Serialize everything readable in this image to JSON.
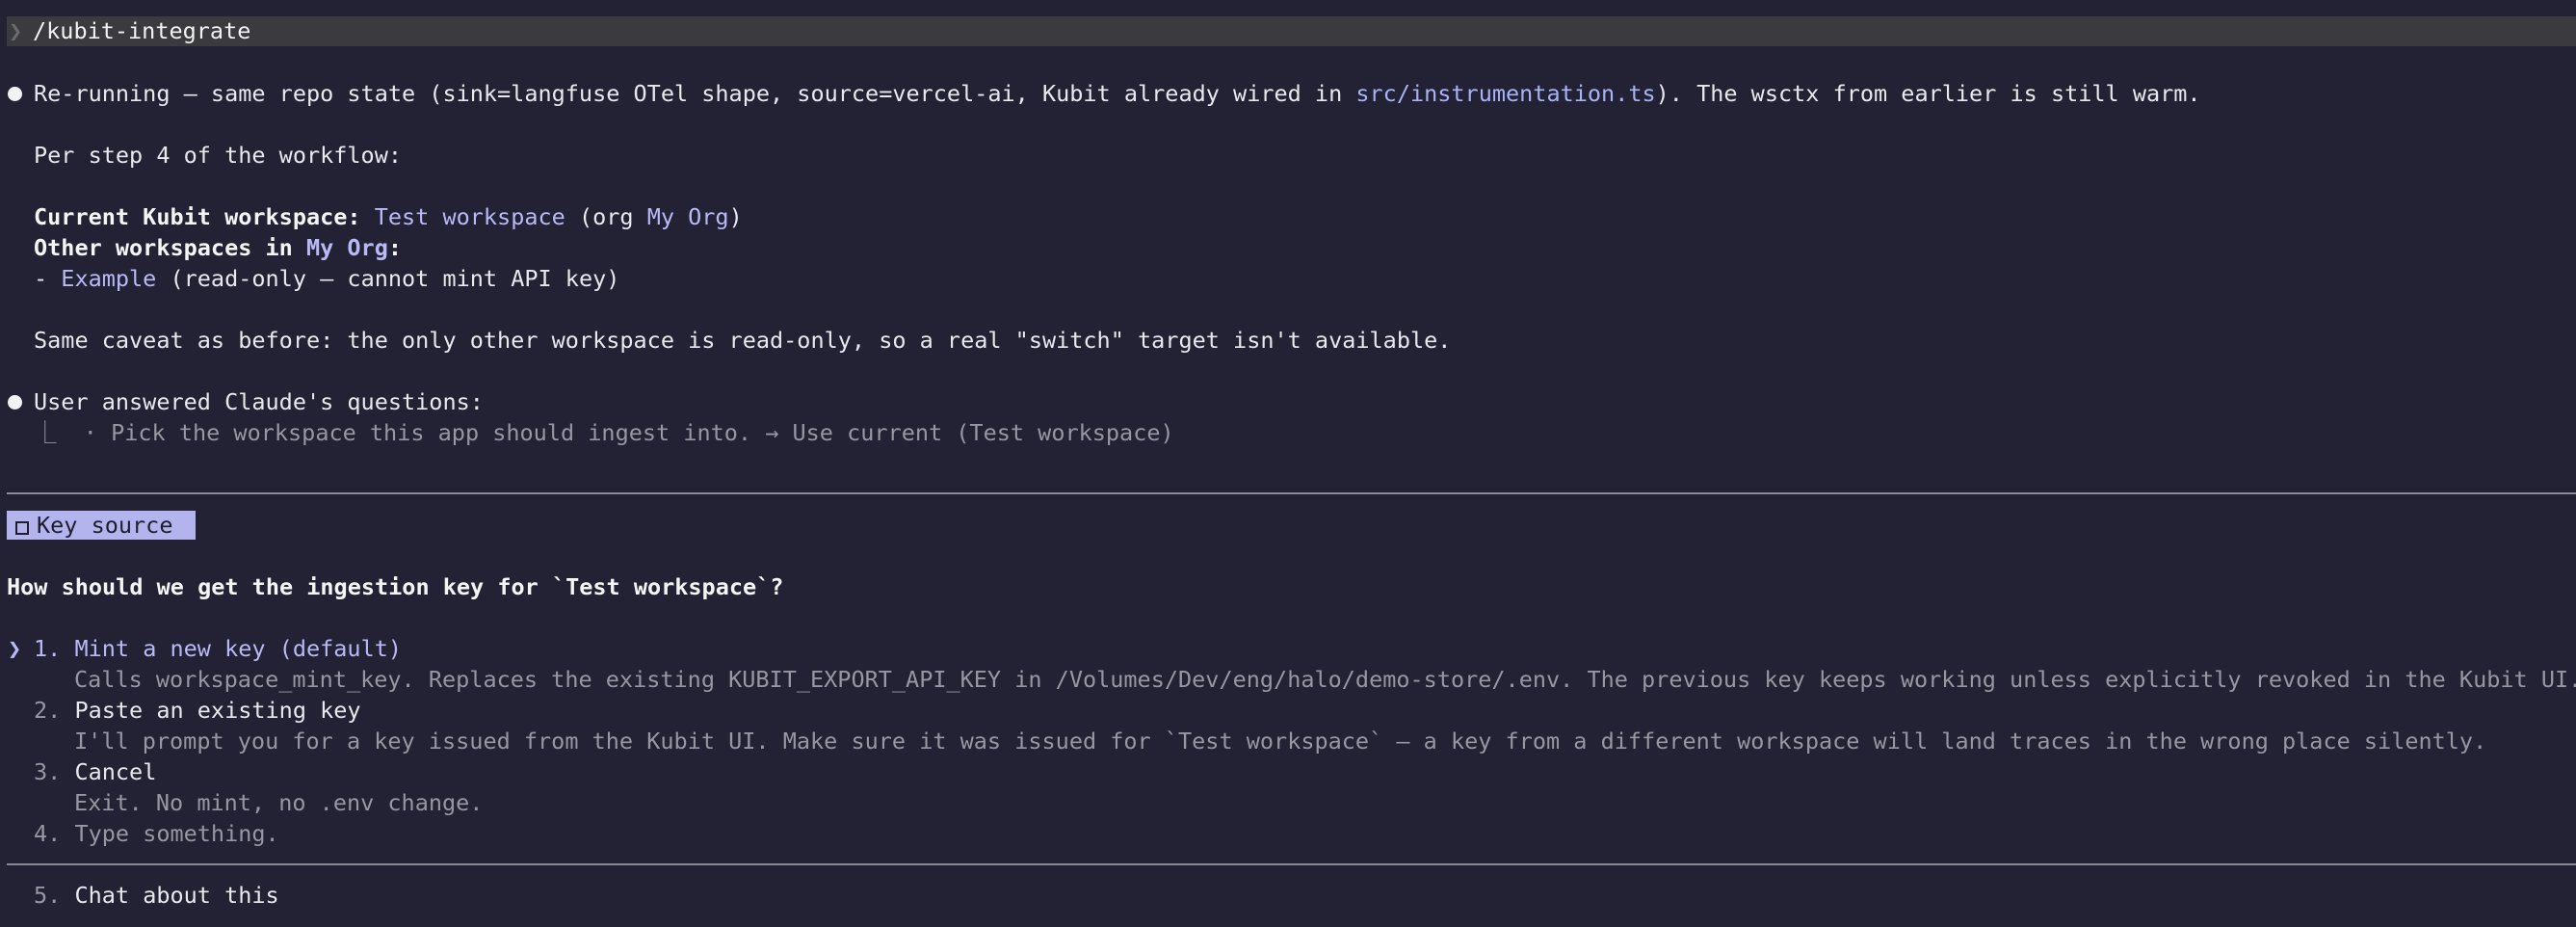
{
  "command": {
    "caret": "❯",
    "text": "/kubit-integrate"
  },
  "message1": {
    "intro_before": "Re-running — same repo state (sink=langfuse OTel shape, source=vercel-ai, Kubit already wired in ",
    "intro_path": "src/instrumentation.ts",
    "intro_after": "). The wsctx from earlier is still warm.",
    "step_line": "Per step 4 of the workflow:",
    "current_label": "Current Kubit workspace:",
    "current_workspace": "Test workspace",
    "current_org_prefix": " (org ",
    "current_org": "My Org",
    "current_org_suffix": ")",
    "other_label_prefix": "Other workspaces in ",
    "other_label_org": "My Org",
    "other_label_suffix": ":",
    "other_item_dash": "- ",
    "other_item_name": "Example",
    "other_item_note": " (read-only — cannot mint API key)",
    "caveat": "Same caveat as before: the only other workspace is read-only, so a real \"switch\" target isn't available."
  },
  "message2": {
    "title": "User answered Claude's questions:",
    "tree_glyph": "⎿",
    "answer": "· Pick the workspace this app should ingest into. → Use current (Test workspace)"
  },
  "question": {
    "badge_label": "Key source",
    "prompt": "How should we get the ingestion key for `Test workspace`?",
    "selector": "❯",
    "options": [
      {
        "num": "1.",
        "label": "Mint a new key (default)",
        "description": "Calls workspace_mint_key. Replaces the existing KUBIT_EXPORT_API_KEY in /Volumes/Dev/eng/halo/demo-store/.env. The previous key keeps working unless explicitly revoked in the Kubit UI."
      },
      {
        "num": "2.",
        "label": "Paste an existing key",
        "description": "I'll prompt you for a key issued from the Kubit UI. Make sure it was issued for `Test workspace` — a key from a different workspace will land traces in the wrong place silently."
      },
      {
        "num": "3.",
        "label": "Cancel",
        "description": "Exit. No mint, no .env change."
      },
      {
        "num": "4.",
        "label": "Type something."
      }
    ],
    "chat_option": {
      "num": "5.",
      "label": "Chat about this"
    }
  }
}
